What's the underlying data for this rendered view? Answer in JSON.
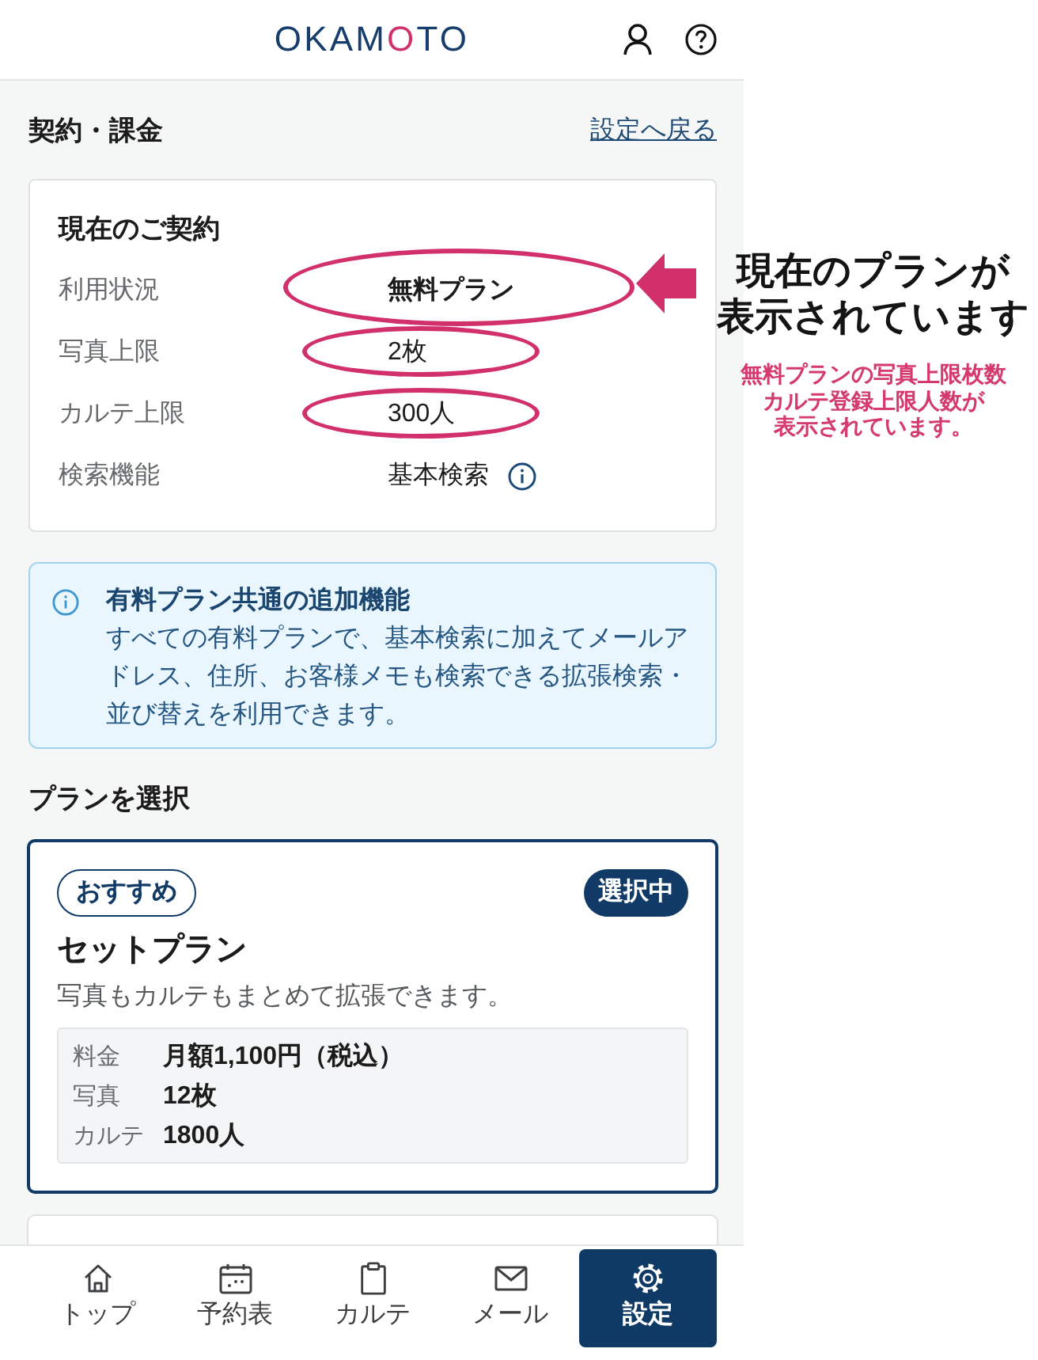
{
  "header": {
    "logo": [
      {
        "text": "OKAM",
        "accent": false
      },
      {
        "text": "O",
        "accent": true
      },
      {
        "text": "TO",
        "accent": false
      }
    ]
  },
  "page": {
    "title": "契約・課金",
    "back_link": "設定へ戻る"
  },
  "contract": {
    "title": "現在のご契約",
    "rows": [
      {
        "label": "利用状況",
        "value": "無料プラン",
        "kind": "plan",
        "highlighted": true
      },
      {
        "label": "写真上限",
        "value": "2枚",
        "kind": "text",
        "highlighted": true
      },
      {
        "label": "カルテ上限",
        "value": "300人",
        "kind": "text",
        "highlighted": true
      },
      {
        "label": "検索機能",
        "value": "基本検索",
        "kind": "info",
        "highlighted": false
      }
    ]
  },
  "notice": {
    "title": "有料プラン共通の追加機能",
    "body": "すべての有料プランで、基本検索に加えてメールアドレス、住所、お客様メモも検索できる拡張検索・並び替えを利用できます。"
  },
  "plans": {
    "title": "プランを選択",
    "items": [
      {
        "badge": "おすすめ",
        "status": "選択中",
        "selected": true,
        "name": "セットプラン",
        "description": "写真もカルテもまとめて拡張できます。",
        "specs": [
          {
            "label": "料金",
            "value": "月額1,100円（税込）"
          },
          {
            "label": "写真",
            "value": "12枚"
          },
          {
            "label": "カルテ",
            "value": "1800人"
          }
        ]
      },
      {
        "selected": false
      }
    ]
  },
  "nav": [
    {
      "label": "トップ",
      "selected": false
    },
    {
      "label": "予約表",
      "selected": false
    },
    {
      "label": "カルテ",
      "selected": false
    },
    {
      "label": "メール",
      "selected": false
    },
    {
      "label": "設定",
      "selected": true
    }
  ],
  "callout": {
    "title_lines": [
      "現在のプランが",
      "表示されています"
    ],
    "note_lines": [
      "無料プランの写真上限枚数",
      "カルテ登録上限人数が",
      "表示されています。"
    ]
  }
}
